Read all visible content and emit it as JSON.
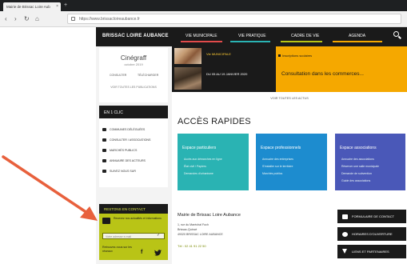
{
  "browser": {
    "tab_title": "Mairie de Brissac Loire Aub",
    "tab_close": "×",
    "new_tab": "+",
    "back": "‹",
    "forward": "›",
    "reload": "↻",
    "home": "⌂",
    "url": "https://www.brissacloireaubance.fr"
  },
  "header": {
    "logo": "BRISSAC LOIRE AUBANCE",
    "nav": [
      {
        "label": "VIE MUNICIPALE",
        "color": "#e14b4b"
      },
      {
        "label": "VIE PRATIQUE",
        "color": "#2ab3b3"
      },
      {
        "label": "CADRE DE VIE",
        "color": "#b9c416"
      },
      {
        "label": "AGENDA",
        "color": "#f5a800"
      }
    ]
  },
  "event_card": {
    "title": "Cinégraff",
    "date": "octobre 2019",
    "link1": "CONSULTER",
    "link2": "TÉLÉCHARGER",
    "all_link": "VOIR TOUTES LES PUBLICATIONS"
  },
  "quick_panel": {
    "heading": "EN 1 CLIC",
    "items": [
      "COMMUNES DÉLÉGUÉES",
      "CONSULTER / ASSOCIATIONS",
      "MARCHÉS PUBLICS",
      "ANNUAIRE DES ACTEURS",
      "SUIVEZ NOUS SUR"
    ]
  },
  "contact": {
    "heading": "RESTONS EN CONTACT",
    "text": "Recevez nos actualités et informations",
    "email_placeholder": "Votre adresse e-mail",
    "email_ok": "✓",
    "follow": "Retrouvez-nous sur les réseaux",
    "fb": "f",
    "tw": "🐦"
  },
  "news": {
    "item1_tag": "Vie MUNICIPALE",
    "item1_text": "Inscriptions scolaires",
    "item2_date": "DU 05 AU 19 JANVIER 2020",
    "item2_title": "Consultation dans les commerces...",
    "all_news": "VOIR TOUTES LES ACTUS"
  },
  "acces": {
    "title": "ACCÈS RAPIDES",
    "tiles": [
      {
        "title": "Espace particuliers",
        "items": [
          "Accès aux démarches en ligne",
          "État civil / Papiers",
          "Demandes d'urbanisme"
        ]
      },
      {
        "title": "Espace professionnels",
        "items": [
          "Annuaire des entreprises",
          "S'installer sur le territoire",
          "Marchés publics"
        ]
      },
      {
        "title": "Espace associations",
        "items": [
          "Annuaire des associations",
          "Réserver une salle municipale",
          "Demande de subvention",
          "Guide des associations"
        ]
      }
    ]
  },
  "mairie": {
    "name": "Mairie de Brissac Loire Aubance",
    "addr1": "1, rue du Maréchal Foch",
    "addr2": "Brissac-Quincé",
    "addr3": "49320 BRISSAC LOIRE AUBANCE",
    "tel": "Tél : 02 41 91 22 50",
    "buttons": [
      "FORMULAIRE DE CONTACT",
      "HORAIRES D'OUVERTURE",
      "LIENS ET PARTENAIRES"
    ]
  },
  "colors": {
    "header_bg": "#1a1a1a",
    "accent_yellow": "#f5a800",
    "contact_green": "#b9c416",
    "tile_teal": "#2ab3b3",
    "tile_blue": "#1d8ccf",
    "tile_indigo": "#4a58b8",
    "annotation_arrow": "#e8603c"
  }
}
